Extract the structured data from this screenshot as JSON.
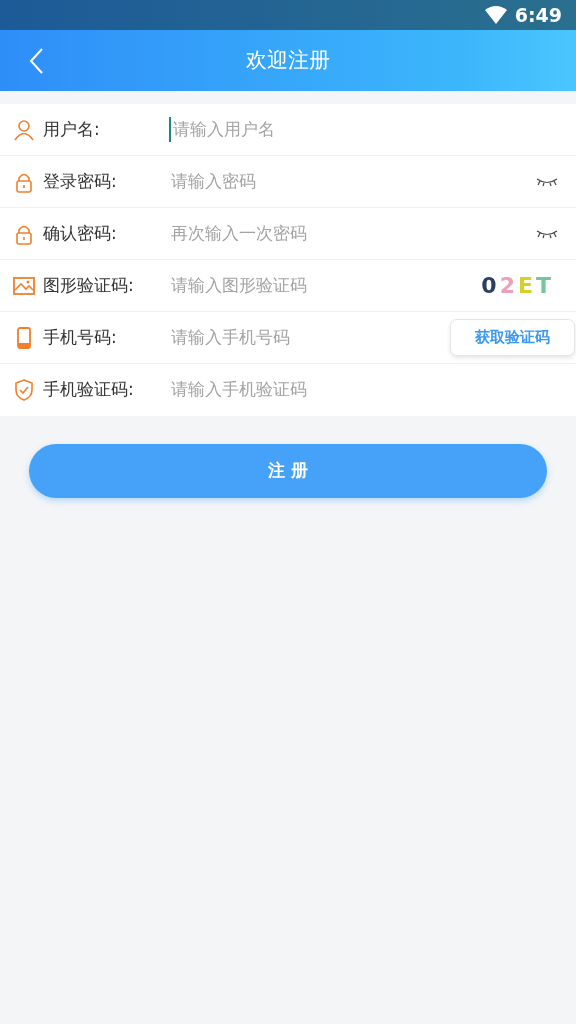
{
  "status_bar": {
    "time": "6:49"
  },
  "header": {
    "title": "欢迎注册"
  },
  "fields": [
    {
      "kind": "user",
      "label": "用户名:",
      "placeholder": "请输入用户名",
      "focused": true
    },
    {
      "kind": "password",
      "label": "登录密码:",
      "placeholder": "请输入密码",
      "focused": false
    },
    {
      "kind": "password",
      "label": "确认密码:",
      "placeholder": "再次输入一次密码",
      "focused": false
    },
    {
      "kind": "captcha",
      "label": "图形验证码:",
      "placeholder": "请输入图形验证码",
      "focused": false,
      "captcha": [
        {
          "char": "0",
          "color": "#2b3f63"
        },
        {
          "char": "2",
          "color": "#ef9fb8"
        },
        {
          "char": "E",
          "color": "#d6d02a"
        },
        {
          "char": "T",
          "color": "#74c79a"
        }
      ]
    },
    {
      "kind": "phone",
      "label": "手机号码:",
      "placeholder": "请输入手机号码",
      "focused": false,
      "button": "获取验证码"
    },
    {
      "kind": "sms",
      "label": "手机验证码:",
      "placeholder": "请输入手机验证码",
      "focused": false
    }
  ],
  "submit": "注 册"
}
